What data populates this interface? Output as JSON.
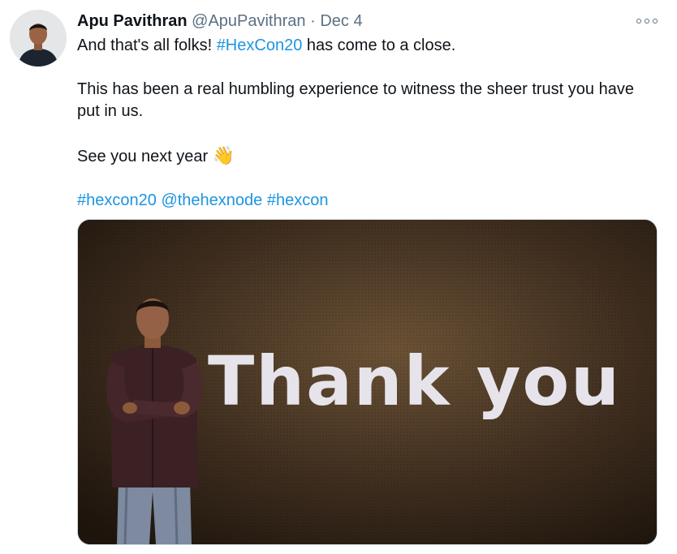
{
  "tweet": {
    "author": {
      "display_name": "Apu Pavithran",
      "handle": "@ApuPavithran"
    },
    "separator": "·",
    "date": "Dec 4",
    "more_icon": "more-horizontal-icon",
    "body": {
      "line1_prefix": "And that's all folks! ",
      "line1_hashtag": "#HexCon20",
      "line1_suffix": " has come to a close.",
      "paragraph2": "This has been a real humbling experience to witness the sheer trust you have put in us.",
      "paragraph3": "See you next year ",
      "emoji": "👋",
      "tags": [
        "#hexcon20",
        "@thehexnode",
        "#hexcon"
      ]
    },
    "media": {
      "screen_text": "Thank you"
    }
  },
  "colors": {
    "link": "#1b95e0",
    "secondary": "#5b7083",
    "primary_text": "#0f1419",
    "media_background": "#2b2017"
  }
}
